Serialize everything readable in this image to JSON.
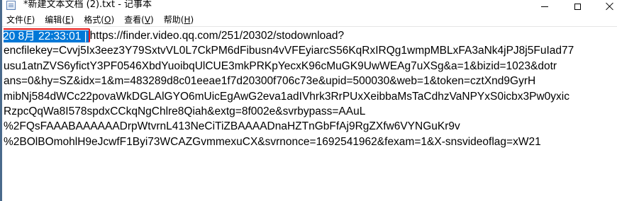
{
  "window": {
    "title": "*新建文本文档 (2).txt - 记事本"
  },
  "menu": {
    "items": [
      {
        "label": "文件",
        "key": "F"
      },
      {
        "label": "编辑",
        "key": "E"
      },
      {
        "label": "格式",
        "key": "O"
      },
      {
        "label": "查看",
        "key": "V"
      },
      {
        "label": "帮助",
        "key": "H"
      }
    ]
  },
  "editor": {
    "selected_text": "20 8月 22:33:01 |",
    "lines": [
      "https://finder.video.qq.com/251/20302/stodownload?",
      "encfilekey=Cvvj5Ix3eez3Y79SxtvVL0L7CkPM6dFibusn4vVFEyiarcS56KqRxIRQg1wmpMBLxFA3aNk4jPJ8j5FuIad77",
      "usu1atnZVS6yfictY3PF0546XbdYuoibqUlCUE3mkPRKpYecxK96cMuGK9UwWEAg7uXSg&a=1&bizid=1023&dotr",
      "ans=0&hy=SZ&idx=1&m=483289d8c01eeae1f7d20300f706c73e&upid=500030&web=1&token=cztXnd9GyrH",
      "mibNj584dWCc22povaWkDGLAlGYO6mUicEgAwG2eva1adIVhrk3RrPUxXeibbaMsTaCdhzVaNPYxS0icbx3Pw0yxic",
      "RzpcQqWa8I578spdxCCkqNgChlre8Qiah&extg=8f002e&svrbypass=AAuL",
      "%2FQsFAAABAAAAAADrpWtvrnL413NeCiTiZBAAAADnaHZTnGbFfAj9RgZXfw6VYNGuKr9v",
      "%2BOlBOmohlH9eJcwfF1Byi73WCAZGvmmexuCX&svrnonce=1692541962&fexam=1&X-snsvideoflag=xW21"
    ]
  },
  "colors": {
    "selection": "#0078d7",
    "highlight_border": "#e21a1a"
  }
}
